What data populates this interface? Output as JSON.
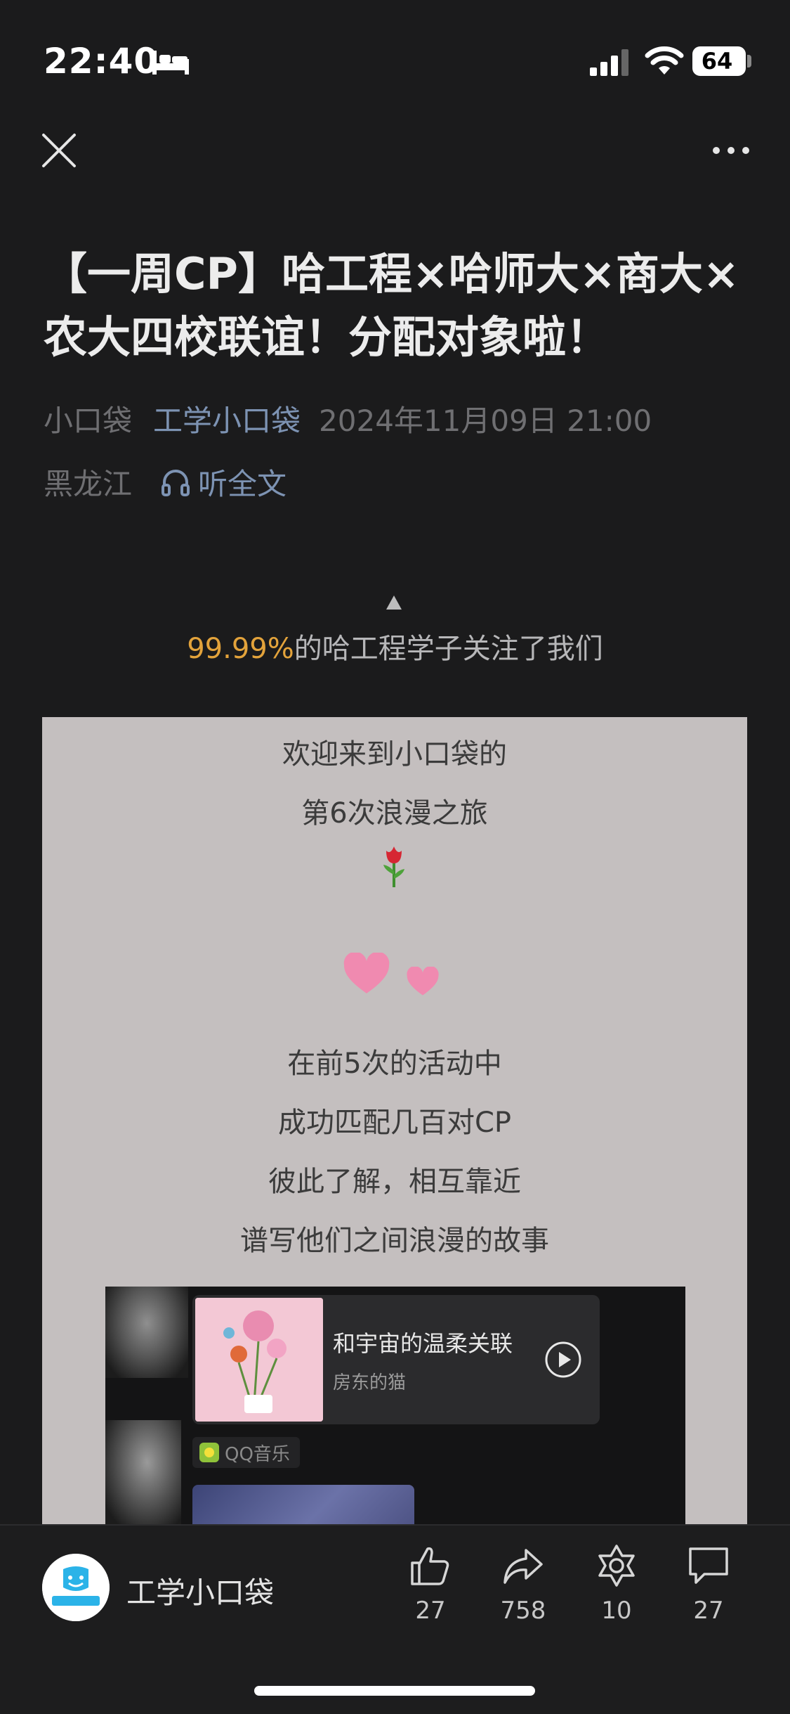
{
  "status_bar": {
    "time": "22:40",
    "battery": "64"
  },
  "nav": {
    "close_icon": "close-icon",
    "more_icon": "more-icon"
  },
  "article": {
    "title": "【一周CP】哈工程×哈师大×商大×农大四校联谊！分配对象啦！",
    "author": "小口袋",
    "account": "工学小口袋",
    "datetime": "2024年11月09日 21:00",
    "location": "黑龙江",
    "listen_label": "听全文"
  },
  "stat": {
    "percent": "99.99%",
    "text": "的哈工程学子关注了我们"
  },
  "content": {
    "lines_top": [
      "欢迎来到小口袋的",
      "第6次浪漫之旅"
    ],
    "lines_mid": [
      "在前5次的活动中",
      "成功匹配几百对CP",
      "彼此了解，相互靠近",
      "谱写他们之间浪漫的故事"
    ],
    "music": {
      "song": "和宇宙的温柔关联",
      "artist": "房东的猫",
      "source": "QQ音乐"
    }
  },
  "bottom": {
    "account_name": "工学小口袋",
    "like_count": "27",
    "share_count": "758",
    "recommend_count": "10",
    "comment_count": "27"
  },
  "colors": {
    "background": "#1b1b1c",
    "accent_link": "#7d93b3",
    "highlight": "#e3a33b",
    "card": "#c4bfbf"
  }
}
